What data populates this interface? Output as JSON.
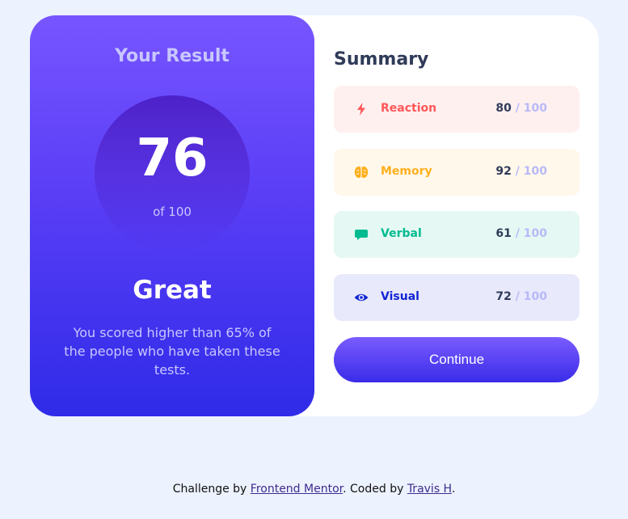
{
  "result": {
    "title": "Your Result",
    "score": "76",
    "score_of": "of 100",
    "grade": "Great",
    "description": "You scored higher than 65% of the people who have taken these tests."
  },
  "summary": {
    "title": "Summary",
    "items": [
      {
        "label": "Reaction",
        "score": "80",
        "max": " / 100",
        "icon": "lightning-icon",
        "color": "#ff5757",
        "bg": "#fff0f0"
      },
      {
        "label": "Memory",
        "score": "92",
        "max": " / 100",
        "icon": "brain-icon",
        "color": "#ffb01e",
        "bg": "#fff8eb"
      },
      {
        "label": "Verbal",
        "score": "61",
        "max": " / 100",
        "icon": "speech-bubble-icon",
        "color": "#00bb8f",
        "bg": "#e5f8f3"
      },
      {
        "label": "Visual",
        "score": "72",
        "max": " / 100",
        "icon": "eye-icon",
        "color": "#1125d4",
        "bg": "#e8e9fb"
      }
    ],
    "continue_label": "Continue"
  },
  "footer": {
    "prefix": "Challenge by ",
    "link1": "Frontend Mentor",
    "middle": ". Coded by ",
    "link2": "Travis H",
    "suffix": "."
  }
}
